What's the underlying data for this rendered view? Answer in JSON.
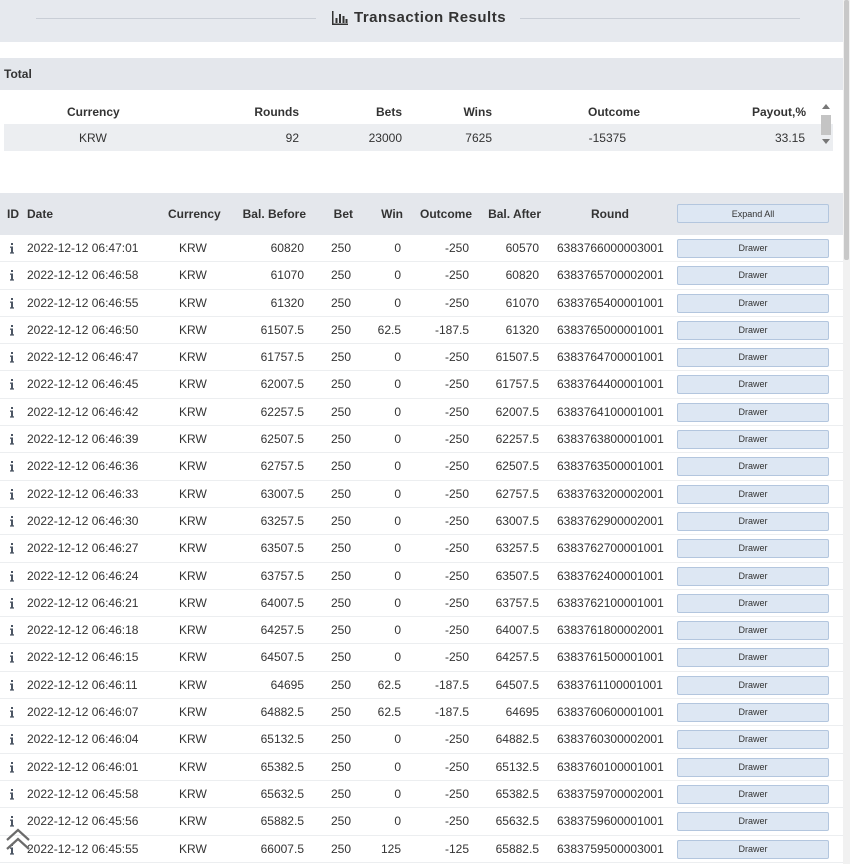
{
  "header": {
    "title": "Transaction Results",
    "icon": "bar-chart-icon"
  },
  "total": {
    "label": "Total",
    "columns": [
      "Currency",
      "Rounds",
      "Bets",
      "Wins",
      "Outcome",
      "Payout,%"
    ],
    "row": [
      "KRW",
      "92",
      "23000",
      "7625",
      "-15375",
      "33.15"
    ]
  },
  "table": {
    "columns": [
      "ID",
      "Date",
      "Currency",
      "Bal. Before",
      "Bet",
      "Win",
      "Outcome",
      "Bal. After",
      "Round"
    ],
    "expand_label": "Expand All",
    "drawer_label": "Drawer",
    "rows": [
      [
        "2022-12-12 06:47:01",
        "KRW",
        "60820",
        "250",
        "0",
        "-250",
        "60570",
        "6383766000003001"
      ],
      [
        "2022-12-12 06:46:58",
        "KRW",
        "61070",
        "250",
        "0",
        "-250",
        "60820",
        "6383765700002001"
      ],
      [
        "2022-12-12 06:46:55",
        "KRW",
        "61320",
        "250",
        "0",
        "-250",
        "61070",
        "6383765400001001"
      ],
      [
        "2022-12-12 06:46:50",
        "KRW",
        "61507.5",
        "250",
        "62.5",
        "-187.5",
        "61320",
        "6383765000001001"
      ],
      [
        "2022-12-12 06:46:47",
        "KRW",
        "61757.5",
        "250",
        "0",
        "-250",
        "61507.5",
        "6383764700001001"
      ],
      [
        "2022-12-12 06:46:45",
        "KRW",
        "62007.5",
        "250",
        "0",
        "-250",
        "61757.5",
        "6383764400001001"
      ],
      [
        "2022-12-12 06:46:42",
        "KRW",
        "62257.5",
        "250",
        "0",
        "-250",
        "62007.5",
        "6383764100001001"
      ],
      [
        "2022-12-12 06:46:39",
        "KRW",
        "62507.5",
        "250",
        "0",
        "-250",
        "62257.5",
        "6383763800001001"
      ],
      [
        "2022-12-12 06:46:36",
        "KRW",
        "62757.5",
        "250",
        "0",
        "-250",
        "62507.5",
        "6383763500001001"
      ],
      [
        "2022-12-12 06:46:33",
        "KRW",
        "63007.5",
        "250",
        "0",
        "-250",
        "62757.5",
        "6383763200002001"
      ],
      [
        "2022-12-12 06:46:30",
        "KRW",
        "63257.5",
        "250",
        "0",
        "-250",
        "63007.5",
        "6383762900002001"
      ],
      [
        "2022-12-12 06:46:27",
        "KRW",
        "63507.5",
        "250",
        "0",
        "-250",
        "63257.5",
        "6383762700001001"
      ],
      [
        "2022-12-12 06:46:24",
        "KRW",
        "63757.5",
        "250",
        "0",
        "-250",
        "63507.5",
        "6383762400001001"
      ],
      [
        "2022-12-12 06:46:21",
        "KRW",
        "64007.5",
        "250",
        "0",
        "-250",
        "63757.5",
        "6383762100001001"
      ],
      [
        "2022-12-12 06:46:18",
        "KRW",
        "64257.5",
        "250",
        "0",
        "-250",
        "64007.5",
        "6383761800002001"
      ],
      [
        "2022-12-12 06:46:15",
        "KRW",
        "64507.5",
        "250",
        "0",
        "-250",
        "64257.5",
        "6383761500001001"
      ],
      [
        "2022-12-12 06:46:11",
        "KRW",
        "64695",
        "250",
        "62.5",
        "-187.5",
        "64507.5",
        "6383761100001001"
      ],
      [
        "2022-12-12 06:46:07",
        "KRW",
        "64882.5",
        "250",
        "62.5",
        "-187.5",
        "64695",
        "6383760600001001"
      ],
      [
        "2022-12-12 06:46:04",
        "KRW",
        "65132.5",
        "250",
        "0",
        "-250",
        "64882.5",
        "6383760300002001"
      ],
      [
        "2022-12-12 06:46:01",
        "KRW",
        "65382.5",
        "250",
        "0",
        "-250",
        "65132.5",
        "6383760100001001"
      ],
      [
        "2022-12-12 06:45:58",
        "KRW",
        "65632.5",
        "250",
        "0",
        "-250",
        "65382.5",
        "6383759700002001"
      ],
      [
        "2022-12-12 06:45:56",
        "KRW",
        "65882.5",
        "250",
        "0",
        "-250",
        "65632.5",
        "6383759600001001"
      ],
      [
        "2022-12-12 06:45:55",
        "KRW",
        "66007.5",
        "250",
        "125",
        "-125",
        "65882.5",
        "6383759500003001"
      ]
    ]
  }
}
